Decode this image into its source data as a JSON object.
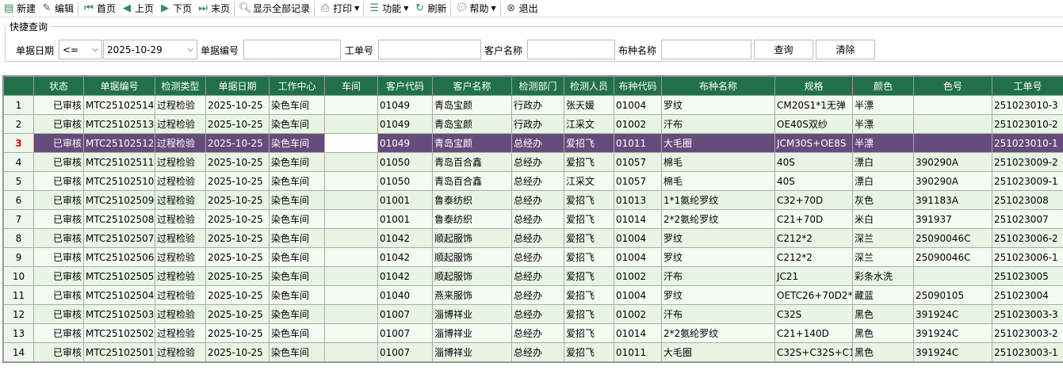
{
  "toolbar": {
    "new": "新建",
    "edit": "编辑",
    "first": "首页",
    "prev": "上页",
    "next": "下页",
    "last": "末页",
    "show_all": "显示全部记录",
    "print": "打印",
    "functions": "功能",
    "refresh": "刷新",
    "help": "帮助",
    "exit": "退出"
  },
  "query": {
    "title": "快捷查询",
    "date_label": "单据日期",
    "op": "<=",
    "date": "2025-10-29",
    "doc_no_label": "单据编号",
    "doc_no": "",
    "wo_label": "工单号",
    "wo": "",
    "cust_label": "客户名称",
    "cust": "",
    "fabric_label": "布种名称",
    "fabric": "",
    "search": "查询",
    "clear": "清除"
  },
  "columns": [
    "状态",
    "单据编号",
    "检测类型",
    "单据日期",
    "工作中心",
    "车间",
    "客户代码",
    "客户名称",
    "检测部门",
    "检测人员",
    "布种代码",
    "布种名称",
    "规格",
    "颜色",
    "色号",
    "工单号"
  ],
  "selected_row": 3,
  "rows": [
    [
      "1",
      "已审核",
      "MTC25102514",
      "过程检验",
      "2025-10-25",
      "染色车间",
      "",
      "01049",
      "青岛宝颜",
      "行政办",
      "张天媛",
      "01004",
      "罗纹",
      "CM20S1*1无弹",
      "半漂",
      "",
      "251023010-3"
    ],
    [
      "2",
      "已审核",
      "MTC25102513",
      "过程检验",
      "2025-10-25",
      "染色车间",
      "",
      "01049",
      "青岛宝颜",
      "行政办",
      "江采文",
      "01002",
      "汗布",
      "OE40S双纱",
      "半漂",
      "",
      "251023010-2"
    ],
    [
      "3",
      "已审核",
      "MTC25102512",
      "过程检验",
      "2025-10-25",
      "染色车间",
      "",
      "01049",
      "青岛宝颜",
      "总经办",
      "爱招飞",
      "01011",
      "大毛圈",
      "JCM30S+OE8S",
      "半漂",
      "",
      "251023010-1"
    ],
    [
      "4",
      "已审核",
      "MTC25102511",
      "过程检验",
      "2025-10-25",
      "染色车间",
      "",
      "01050",
      "青岛百合鑫",
      "总经办",
      "爱招飞",
      "01057",
      "棉毛",
      "40S",
      "漂白",
      "390290A",
      "251023009-2"
    ],
    [
      "5",
      "已审核",
      "MTC25102510",
      "过程检验",
      "2025-10-25",
      "染色车间",
      "",
      "01050",
      "青岛百合鑫",
      "总经办",
      "江采文",
      "01057",
      "棉毛",
      "40S",
      "漂白",
      "390290A",
      "251023009-1"
    ],
    [
      "6",
      "已审核",
      "MTC25102509",
      "过程检验",
      "2025-10-25",
      "染色车间",
      "",
      "01001",
      "鲁泰纺织",
      "总经办",
      "爱招飞",
      "01013",
      "1*1氨纶罗纹",
      "C32+70D",
      "灰色",
      "391183A",
      "251023008"
    ],
    [
      "7",
      "已审核",
      "MTC25102508",
      "过程检验",
      "2025-10-25",
      "染色车间",
      "",
      "01001",
      "鲁泰纺织",
      "总经办",
      "爱招飞",
      "01014",
      "2*2氨纶罗纹",
      "C21+70D",
      "米白",
      "391937",
      "251023007"
    ],
    [
      "8",
      "已审核",
      "MTC25102507",
      "过程检验",
      "2025-10-25",
      "染色车间",
      "",
      "01042",
      "顺起服饰",
      "总经办",
      "爱招飞",
      "01004",
      "罗纹",
      "C212*2",
      "深兰",
      "25090046C",
      "251023006-2"
    ],
    [
      "9",
      "已审核",
      "MTC25102506",
      "过程检验",
      "2025-10-25",
      "染色车间",
      "",
      "01042",
      "顺起服饰",
      "总经办",
      "爱招飞",
      "01004",
      "罗纹",
      "C212*2",
      "深兰",
      "25090046C",
      "251023006-1"
    ],
    [
      "10",
      "已审核",
      "MTC25102505",
      "过程检验",
      "2025-10-25",
      "染色车间",
      "",
      "01042",
      "顺起服饰",
      "总经办",
      "爱招飞",
      "01002",
      "汗布",
      "JC21",
      "彩条水洗",
      "",
      "251023005"
    ],
    [
      "11",
      "已审核",
      "MTC25102504",
      "过程检验",
      "2025-10-25",
      "染色车间",
      "",
      "01040",
      "燕来服饰",
      "总经办",
      "爱招飞",
      "01004",
      "罗纹",
      "OETC26+70D2*",
      "藏蓝",
      "25090105",
      "251023004"
    ],
    [
      "12",
      "已审核",
      "MTC25102503",
      "过程检验",
      "2025-10-25",
      "染色车间",
      "",
      "01007",
      "淄博祥业",
      "总经办",
      "爱招飞",
      "01002",
      "汗布",
      "C32S",
      "黑色",
      "391924C",
      "251023003-3"
    ],
    [
      "13",
      "已审核",
      "MTC25102502",
      "过程检验",
      "2025-10-25",
      "染色车间",
      "",
      "01007",
      "淄博祥业",
      "总经办",
      "爱招飞",
      "01014",
      "2*2氨纶罗纹",
      "C21+140D",
      "黑色",
      "391924C",
      "251023003-2"
    ],
    [
      "14",
      "已审核",
      "MTC25102501",
      "过程检验",
      "2025-10-25",
      "染色车间",
      "",
      "01007",
      "淄博祥业",
      "总经办",
      "爱招飞",
      "01011",
      "大毛圈",
      "C32S+C32S+C1",
      "黑色",
      "391924C",
      "251023003-1"
    ]
  ]
}
